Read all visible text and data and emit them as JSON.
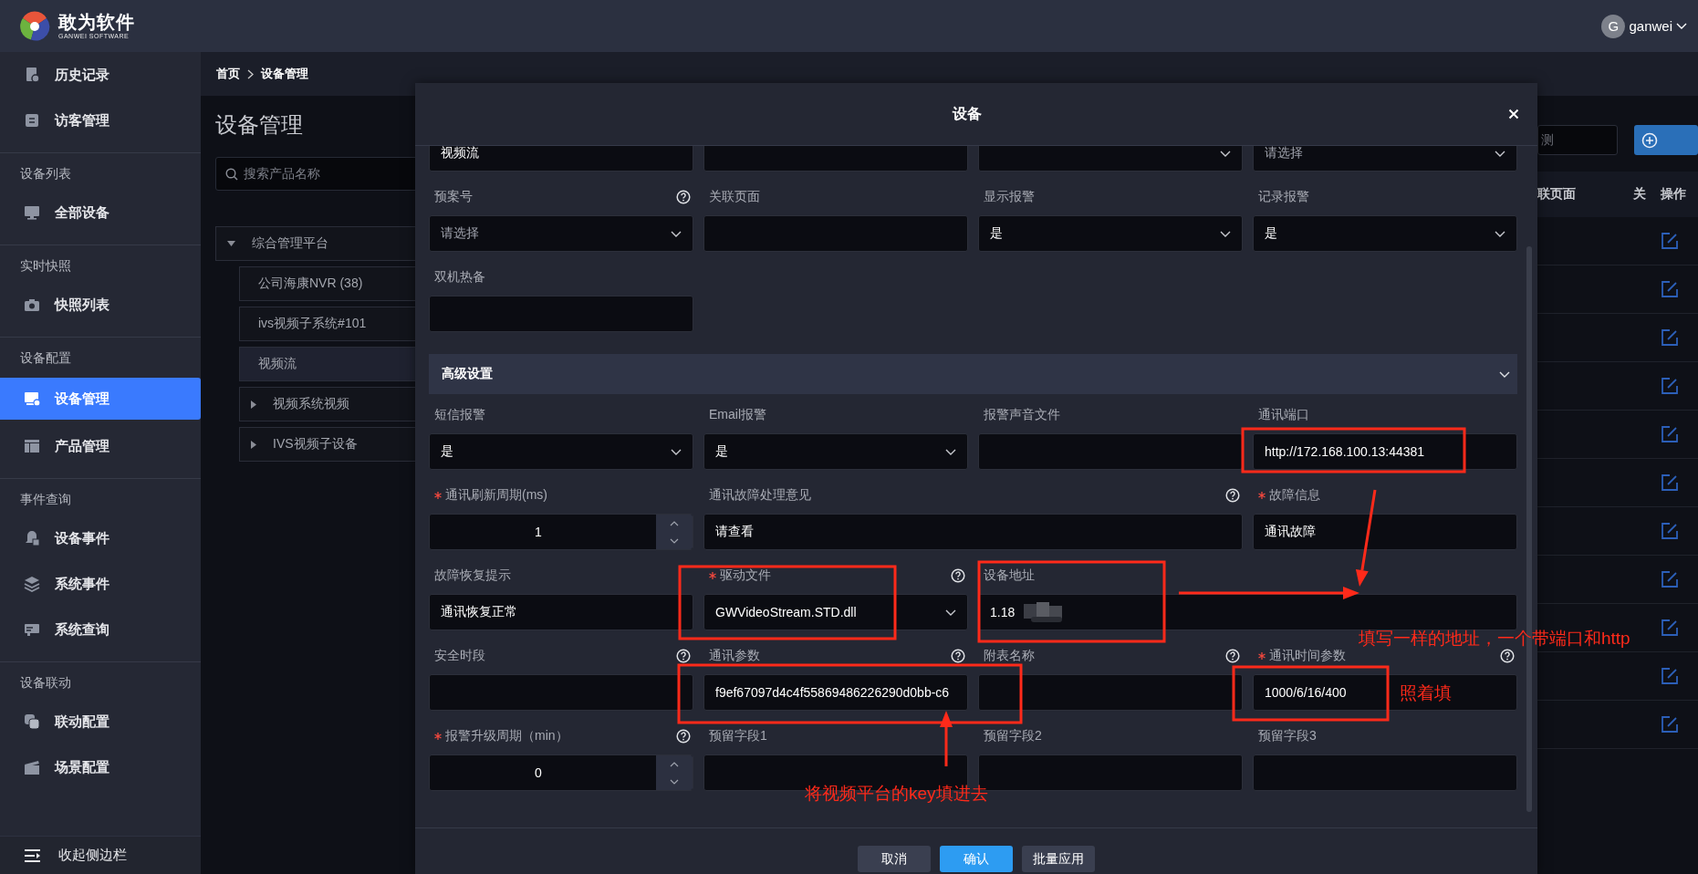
{
  "header": {
    "logo_title": "敢为软件",
    "logo_subtitle": "GANWEI SOFTWARE",
    "avatar_letter": "G",
    "user": "ganwei"
  },
  "sidebar": {
    "items": [
      {
        "kind": "item",
        "label": "历史记录",
        "selected": false
      },
      {
        "kind": "item",
        "label": "访客管理",
        "selected": false
      },
      {
        "kind": "section",
        "label": "设备列表"
      },
      {
        "kind": "item",
        "label": "全部设备",
        "selected": false
      },
      {
        "kind": "section",
        "label": "实时快照"
      },
      {
        "kind": "item",
        "label": "快照列表",
        "selected": false
      },
      {
        "kind": "section",
        "label": "设备配置"
      },
      {
        "kind": "item",
        "label": "设备管理",
        "selected": true
      },
      {
        "kind": "item",
        "label": "产品管理",
        "selected": false
      },
      {
        "kind": "section",
        "label": "事件查询"
      },
      {
        "kind": "item",
        "label": "设备事件",
        "selected": false
      },
      {
        "kind": "item",
        "label": "系统事件",
        "selected": false
      },
      {
        "kind": "item",
        "label": "系统查询",
        "selected": false
      },
      {
        "kind": "section",
        "label": "设备联动"
      },
      {
        "kind": "item",
        "label": "联动配置",
        "selected": false
      },
      {
        "kind": "item",
        "label": "场景配置",
        "selected": false
      }
    ],
    "collapse": "收起侧边栏"
  },
  "breadcrumb": [
    "首页",
    "设备管理"
  ],
  "page_title": "设备管理",
  "tree_search": {
    "placeholder": "搜索产品名称"
  },
  "tree": [
    {
      "label": "综合管理平台",
      "expanded": true,
      "selected": false,
      "children": [
        {
          "label": "公司海康NVR (38)",
          "selected": false
        },
        {
          "label": "ivs视频子系统#101",
          "selected": false
        },
        {
          "label": "视频流",
          "selected": true
        },
        {
          "label": "视频系统视频",
          "expanded": false,
          "selected": false
        },
        {
          "label": "IVS视频子设备",
          "expanded": false,
          "selected": false
        }
      ]
    }
  ],
  "table": {
    "search_value": "测",
    "columns": [
      "联页面",
      "关",
      "操作"
    ],
    "rows": [
      {
        "kind": "edit"
      },
      {
        "kind": "edit"
      },
      {
        "kind": "edit"
      },
      {
        "kind": "edit"
      },
      {
        "kind": "edit"
      },
      {
        "kind": "edit"
      },
      {
        "kind": "edit"
      },
      {
        "kind": "edit"
      },
      {
        "kind": "edit"
      },
      {
        "kind": "edit"
      },
      {
        "kind": "edit"
      }
    ]
  },
  "modal": {
    "title": "设备",
    "sections": [
      {
        "fields": [
          {
            "kind": "input",
            "value": "视频流"
          },
          {
            "kind": "input"
          },
          {
            "kind": "select"
          },
          {
            "kind": "select",
            "placeholder": "请选择"
          },
          {
            "kind": "select",
            "label": "预案号",
            "help": true,
            "placeholder": "请选择"
          },
          {
            "kind": "input",
            "label": "关联页面"
          },
          {
            "kind": "select",
            "label": "显示报警",
            "value": "是"
          },
          {
            "kind": "select",
            "label": "记录报警",
            "value": "是"
          },
          {
            "kind": "input",
            "label": "双机热备"
          }
        ]
      },
      {
        "title": "高级设置",
        "expanded": true,
        "fields": [
          {
            "kind": "select",
            "label": "短信报警",
            "value": "是"
          },
          {
            "kind": "select",
            "label": "Email报警",
            "value": "是"
          },
          {
            "kind": "input",
            "label": "报警声音文件"
          },
          {
            "kind": "input",
            "label": "通讯端口",
            "value": "http://172.168.100.13:44381"
          },
          {
            "kind": "number",
            "label": "通讯刷新周期(ms)",
            "required": true,
            "value": "1"
          },
          {
            "kind": "input",
            "label": "通讯故障处理意见",
            "help": true,
            "wide": true,
            "value": "请查看"
          },
          {
            "kind": "input",
            "label": "故障信息",
            "required": true,
            "value": "通讯故障"
          },
          {
            "kind": "input",
            "label": "故障恢复提示",
            "value": "通讯恢复正常"
          },
          {
            "kind": "select",
            "label": "驱动文件",
            "required": true,
            "help": true,
            "value": "GWVideoStream.STD.dll"
          },
          {
            "kind": "input",
            "label": "设备地址",
            "wide": true,
            "value": "1.18",
            "redacted": true
          },
          {
            "kind": "input",
            "label": "安全时段",
            "help": true
          },
          {
            "kind": "input",
            "label": "通讯参数",
            "help": true,
            "value": "f9ef67097d4c4f55869486226290d0bb-c6"
          },
          {
            "kind": "input",
            "label": "附表名称",
            "help": true
          },
          {
            "kind": "input",
            "label": "通讯时间参数",
            "required": true,
            "help": true,
            "value": "1000/6/16/400"
          },
          {
            "kind": "number",
            "label": "报警升级周期（min）",
            "required": true,
            "help": true,
            "value": "0"
          },
          {
            "kind": "input",
            "label": "预留字段1"
          },
          {
            "kind": "input",
            "label": "预留字段2"
          },
          {
            "kind": "input",
            "label": "预留字段3"
          }
        ]
      }
    ],
    "buttons": [
      {
        "label": "取消",
        "kind": "default"
      },
      {
        "label": "确认",
        "kind": "primary"
      },
      {
        "label": "批量应用",
        "kind": "default"
      }
    ]
  },
  "annotations": [
    {
      "text": "填写一样的地址，一个带端口和http"
    },
    {
      "text": "照着填"
    },
    {
      "text": "将视频平台的key填进去"
    }
  ]
}
